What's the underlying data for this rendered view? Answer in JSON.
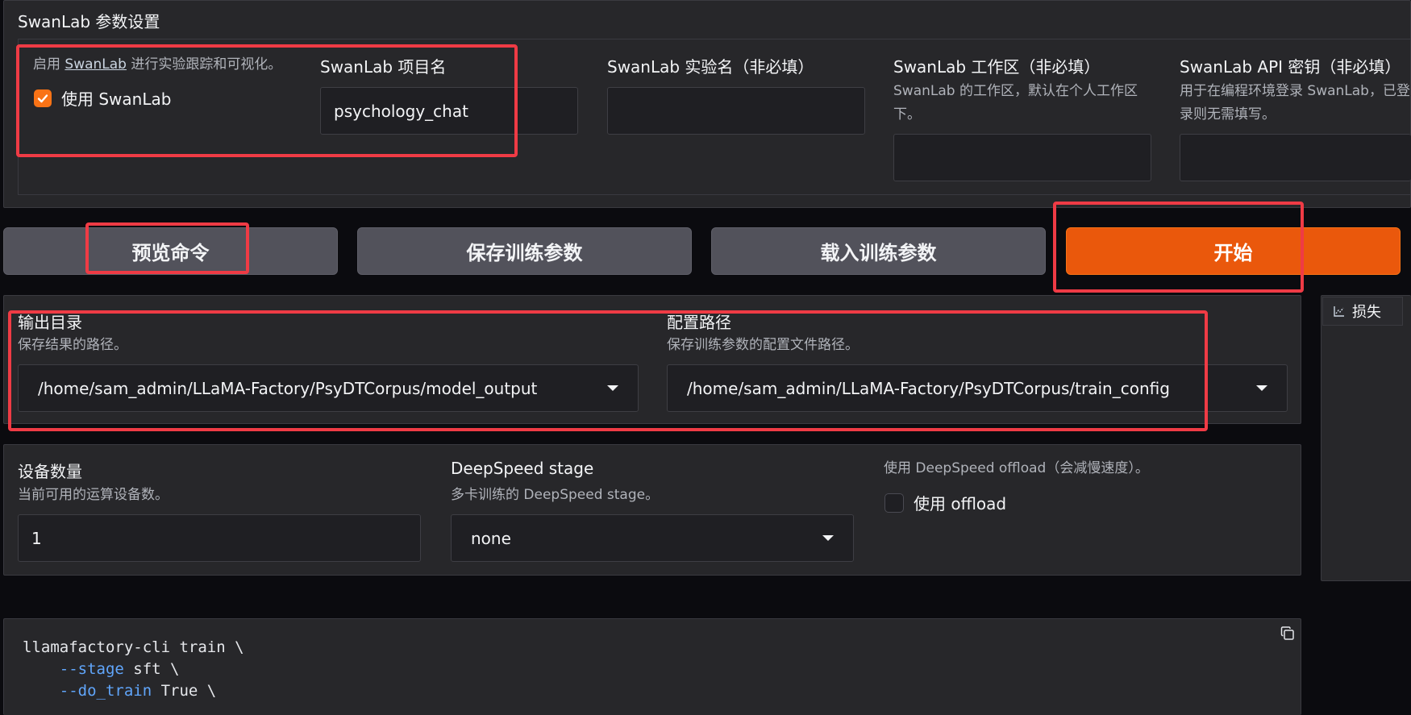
{
  "colors": {
    "accent": "#ea580c",
    "highlight_box": "#ef3b45",
    "panel_bg": "#27272a",
    "page_bg": "#0b0b0f",
    "code_flag": "#60a5fa"
  },
  "swanlab": {
    "section_title": "SwanLab 参数设置",
    "enable_desc_prefix": "启用 ",
    "enable_desc_link": "SwanLab",
    "enable_desc_suffix": " 进行实验跟踪和可视化。",
    "use_label": "使用 SwanLab",
    "use_checked": true,
    "project_label": "SwanLab 项目名",
    "project_value": "psychology_chat",
    "exp_label": "SwanLab 实验名（非必填）",
    "exp_value": "",
    "workspace_label": "SwanLab 工作区（非必填）",
    "workspace_desc": "SwanLab 的工作区，默认在个人工作区下。",
    "workspace_value": "",
    "api_label": "SwanLab API 密钥（非必填）",
    "api_desc": "用于在编程环境登录 SwanLab，已登录则无需填写。",
    "api_value": ""
  },
  "actions": {
    "preview": "预览命令",
    "save": "保存训练参数",
    "load": "载入训练参数",
    "start": "开始"
  },
  "output": {
    "dir_label": "输出目录",
    "dir_desc": "保存结果的路径。",
    "dir_value": "/home/sam_admin/LLaMA-Factory/PsyDTCorpus/model_output",
    "config_label": "配置路径",
    "config_desc": "保存训练参数的配置文件路径。",
    "config_value": "/home/sam_admin/LLaMA-Factory/PsyDTCorpus/train_config"
  },
  "devices": {
    "count_label": "设备数量",
    "count_desc": "当前可用的运算设备数。",
    "count_value": "1",
    "ds_label": "DeepSpeed stage",
    "ds_desc": "多卡训练的 DeepSpeed stage。",
    "ds_value": "none",
    "offload_desc": "使用 DeepSpeed offload（会减慢速度）。",
    "offload_label": "使用 offload",
    "offload_checked": false
  },
  "loss_tab": {
    "icon": "chart-icon",
    "label": "损失"
  },
  "command": {
    "line1": "llamafactory-cli train \\",
    "line2_flag": "--stage",
    "line2_val": " sft \\",
    "line3_flag": "--do_train",
    "line3_val": " True \\"
  }
}
